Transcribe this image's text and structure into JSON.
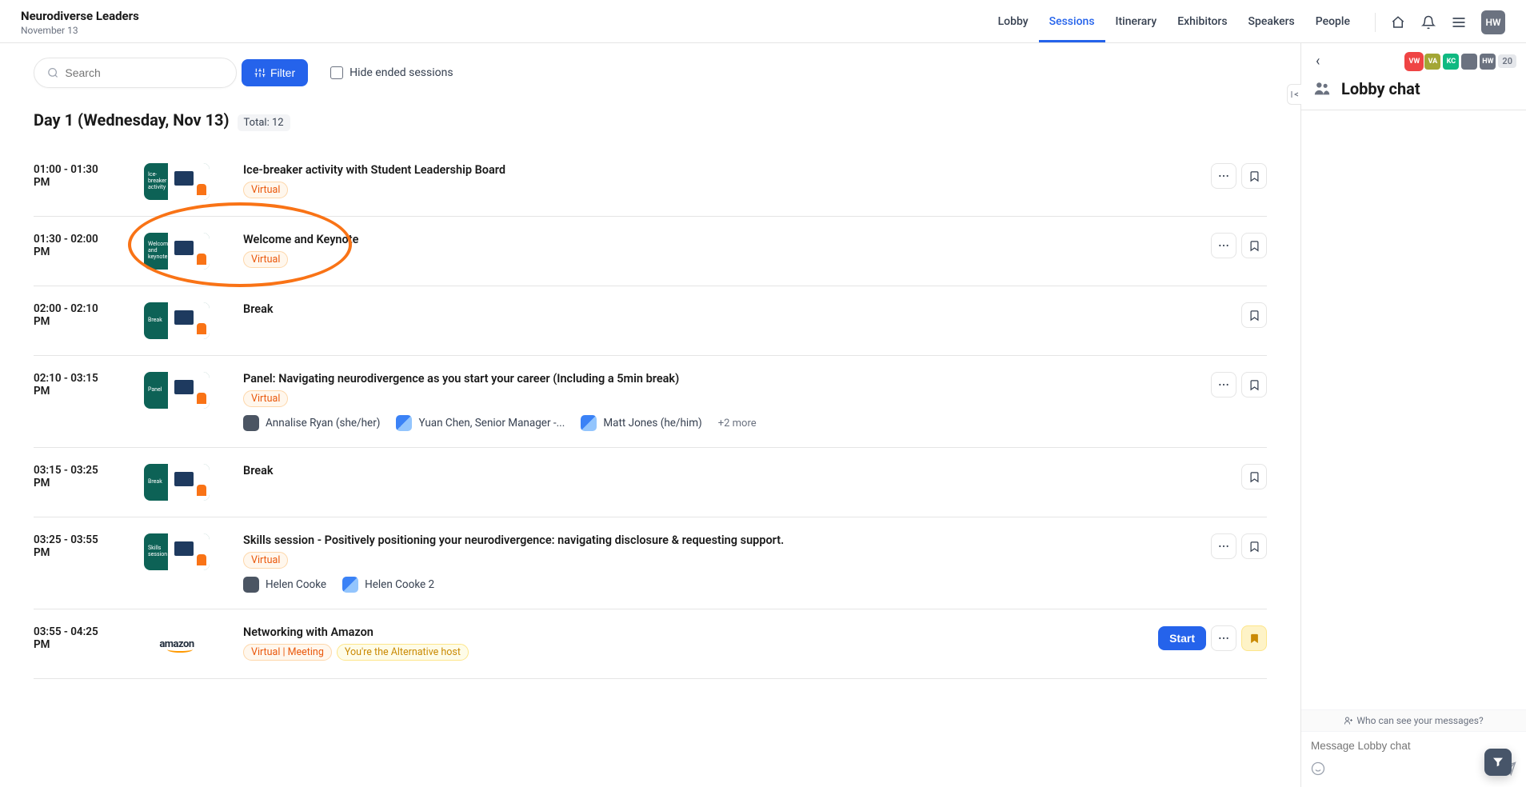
{
  "header": {
    "title": "Neurodiverse Leaders",
    "subtitle": "November 13",
    "nav": [
      "Lobby",
      "Sessions",
      "Itinerary",
      "Exhibitors",
      "Speakers",
      "People"
    ],
    "activeNav": "Sessions",
    "userInitials": "HW"
  },
  "controls": {
    "searchPlaceholder": "Search",
    "filterLabel": "Filter",
    "hideEndedLabel": "Hide ended sessions"
  },
  "day": {
    "title": "Day 1  (Wednesday, Nov 13)",
    "totalLabel": "Total: 12"
  },
  "sessions": [
    {
      "time": "01:00 - 01:30 PM",
      "title": "Ice-breaker activity with Student Leadership Board",
      "thumbLabel": "Ice-breaker activity",
      "tags": [
        {
          "text": "Virtual",
          "style": "virtual"
        }
      ],
      "speakers": [],
      "hasMore": true,
      "hasBookmark": true
    },
    {
      "time": "01:30 - 02:00 PM",
      "title": "Welcome and Keynote",
      "thumbLabel": "Welcome and keynote",
      "tags": [
        {
          "text": "Virtual",
          "style": "virtual"
        }
      ],
      "speakers": [],
      "hasMore": true,
      "hasBookmark": true,
      "highlighted": true
    },
    {
      "time": "02:00 - 02:10 PM",
      "title": "Break",
      "thumbLabel": "Break",
      "tags": [],
      "speakers": [],
      "hasMore": false,
      "hasBookmark": true
    },
    {
      "time": "02:10 - 03:15 PM",
      "title": "Panel: Navigating neurodivergence as you start your career (Including a 5min break)",
      "thumbLabel": "Panel",
      "tags": [
        {
          "text": "Virtual",
          "style": "virtual"
        }
      ],
      "speakers": [
        {
          "name": "Annalise Ryan (she/her)",
          "av": "photo"
        },
        {
          "name": "Yuan Chen, Senior Manager -...",
          "av": "blue"
        },
        {
          "name": "Matt Jones (he/him)",
          "av": "blue"
        }
      ],
      "moreCount": "+2 more",
      "hasMore": true,
      "hasBookmark": true
    },
    {
      "time": "03:15 - 03:25 PM",
      "title": "Break",
      "thumbLabel": "Break",
      "tags": [],
      "speakers": [],
      "hasMore": false,
      "hasBookmark": true
    },
    {
      "time": "03:25 - 03:55 PM",
      "title": "Skills session - Positively positioning your neurodivergence: navigating disclosure & requesting support.",
      "thumbLabel": "Skills session",
      "tags": [
        {
          "text": "Virtual",
          "style": "virtual"
        }
      ],
      "speakers": [
        {
          "name": "Helen Cooke",
          "av": "photo"
        },
        {
          "name": "Helen Cooke 2",
          "av": "blue"
        }
      ],
      "hasMore": true,
      "hasBookmark": true
    },
    {
      "time": "03:55 - 04:25 PM",
      "title": "Networking with Amazon",
      "thumbAmazon": true,
      "tags": [
        {
          "text": "Virtual | Meeting",
          "style": "virtual"
        },
        {
          "text": "You're the Alternative host",
          "style": "yellow"
        }
      ],
      "speakers": [],
      "hasStart": true,
      "startLabel": "Start",
      "hasMore": true,
      "hasBookmark": true,
      "bookmarkActive": true
    }
  ],
  "chat": {
    "title": "Lobby chat",
    "avatars": [
      {
        "t": "VW",
        "c": "#ef4444",
        "ring": true
      },
      {
        "t": "VA",
        "c": "#a3a635"
      },
      {
        "t": "KC",
        "c": "#10b981"
      },
      {
        "t": "",
        "c": "#6b7280"
      },
      {
        "t": "HW",
        "c": "#6b7280"
      }
    ],
    "count": "20",
    "whoCanSee": "Who can see your messages?",
    "inputPlaceholder": "Message Lobby chat"
  }
}
